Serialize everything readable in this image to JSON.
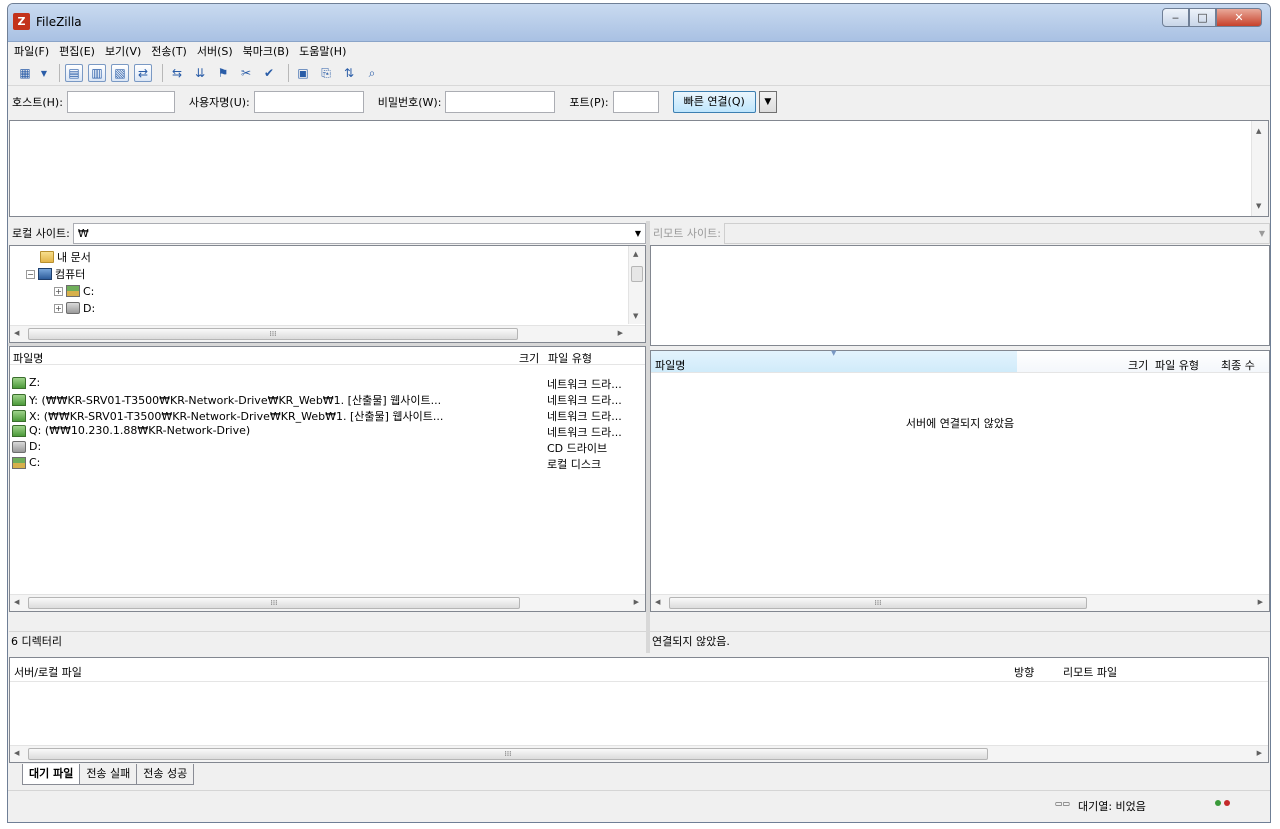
{
  "window": {
    "title": "FileZilla",
    "app_icon_letter": "Z",
    "min_glyph": "‒",
    "max_glyph": "□",
    "close_glyph": "✕"
  },
  "menu": [
    "파일(F)",
    "편집(E)",
    "보기(V)",
    "전송(T)",
    "서버(S)",
    "북마크(B)",
    "도움말(H)"
  ],
  "quickconnect": {
    "host_label": "호스트(H):",
    "user_label": "사용자명(U):",
    "pass_label": "비밀번호(W):",
    "port_label": "포트(P):",
    "connect_label": "빠른 연결(Q)",
    "host_value": "",
    "user_value": "",
    "pass_value": "",
    "port_value": ""
  },
  "local": {
    "site_label": "로컬 사이트:",
    "site_path": "₩",
    "tree": [
      {
        "label": "내 문서",
        "icon": "folder-icon"
      },
      {
        "label": "컴퓨터",
        "icon": "computer-icon"
      },
      {
        "label": "C:",
        "icon": "drive-c-icon"
      },
      {
        "label": "D:",
        "icon": "drive-d-icon"
      }
    ],
    "columns": {
      "name": "파일명",
      "size": "크기",
      "type": "파일 유형"
    },
    "files": [
      {
        "name": "Z:",
        "type": "네트워크 드라...",
        "icon": "network-drive-icon"
      },
      {
        "name": "Y: (₩₩KR-SRV01-T3500₩KR-Network-Drive₩KR_Web₩1. [산출물] 웹사이트...",
        "type": "네트워크 드라...",
        "icon": "network-drive-icon"
      },
      {
        "name": "X: (₩₩KR-SRV01-T3500₩KR-Network-Drive₩KR_Web₩1. [산출물] 웹사이트...",
        "type": "네트워크 드라...",
        "icon": "network-drive-icon"
      },
      {
        "name": "Q: (₩₩10.230.1.88₩KR-Network-Drive)",
        "type": "네트워크 드라...",
        "icon": "network-drive-icon"
      },
      {
        "name": "D:",
        "type": "CD 드라이브",
        "icon": "cd-drive-icon"
      },
      {
        "name": "C:",
        "type": "로컬 디스크",
        "icon": "local-disk-icon"
      }
    ],
    "status": "6 디렉터리"
  },
  "remote": {
    "site_label": "리모트 사이트:",
    "columns": {
      "name": "파일명",
      "size": "크기",
      "type": "파일 유형",
      "modified": "최종 수"
    },
    "empty_message": "서버에 연결되지 않았음",
    "status": "연결되지 않았음."
  },
  "queue": {
    "columns": {
      "server_local": "서버/로컬 파일",
      "direction": "방향",
      "remote": "리모트 파일"
    },
    "tabs": [
      "대기 파일",
      "전송 실패",
      "전송 성공"
    ],
    "status": "대기열: 비었음"
  },
  "scroll_thumb_glyph": "⁞⁞⁞"
}
